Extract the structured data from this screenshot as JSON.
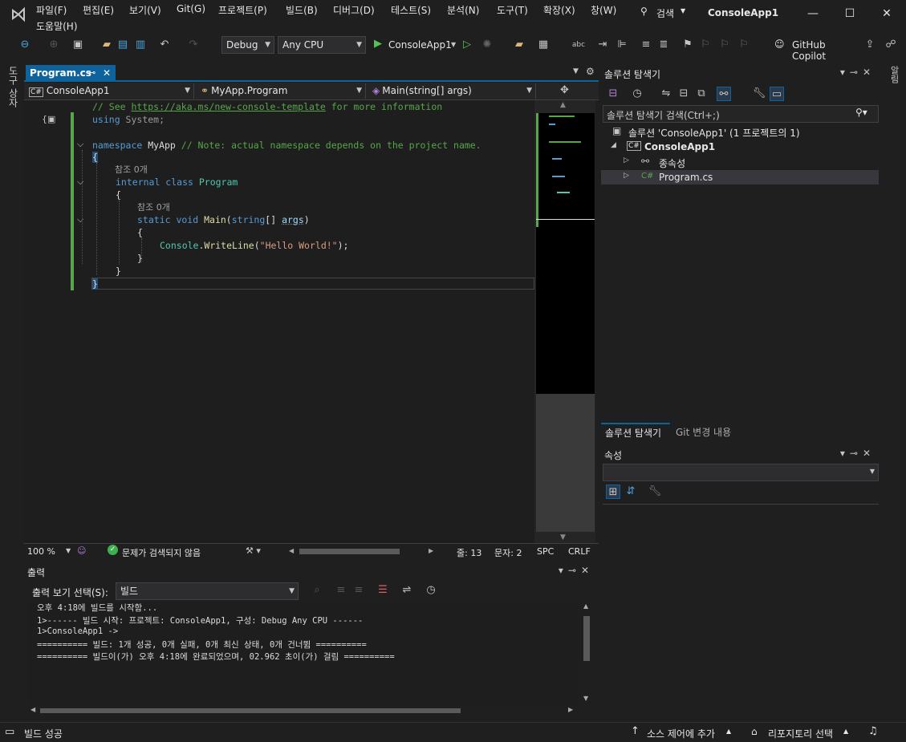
{
  "title_bar": {
    "menus": [
      "파일(F)",
      "편집(E)",
      "보기(V)",
      "Git(G)",
      "프로젝트(P)",
      "빌드(B)",
      "디버그(D)",
      "테스트(S)",
      "분석(N)",
      "도구(T)",
      "확장(X)",
      "창(W)"
    ],
    "help_menu": "도움말(H)",
    "search_label": "검색",
    "solution_name": "ConsoleApp1"
  },
  "toolbar": {
    "config": "Debug",
    "platform": "Any CPU",
    "run_target": "ConsoleApp1",
    "copilot_label": "GitHub Copilot"
  },
  "left_rail": {
    "toolbox_label": "도구 상자"
  },
  "right_rail": {
    "label": "알림"
  },
  "editor": {
    "tab_label": "Program.cs",
    "nav": {
      "project": "ConsoleApp1",
      "class": "MyApp.Program",
      "member": "Main(string[] args)"
    },
    "code": {
      "l1_comment": "// See ",
      "l1_link": "https://aka.ms/new-console-template",
      "l1_tail": " for more information",
      "l2_kw": "using",
      "l2_rest": " System;",
      "l4_kw": "namespace",
      "l4_name": " MyApp ",
      "l4_comment": "// Note: actual namespace depends on the project name.",
      "l5": "{",
      "ref1": "참조 0개",
      "l6_kw": "internal class ",
      "l6_type": "Program",
      "l7": "{",
      "ref2": "참조 0개",
      "l8_kw": "static void ",
      "l8_fn": "Main",
      "l8_p1": "(",
      "l8_kw2": "string",
      "l8_p2": "[] ",
      "l8_arg": "args",
      "l8_p3": ")",
      "l9": "{",
      "l10_type": "Console",
      "l10_dot": ".",
      "l10_fn": "WriteLine",
      "l10_p1": "(",
      "l10_str": "\"Hello World!\"",
      "l10_p2": ");",
      "l11": "}",
      "l12": "}",
      "l13": "}"
    },
    "status": {
      "zoom": "100 %",
      "issues": "문제가 검색되지 않음",
      "line": "줄: 13",
      "char": "문자: 2",
      "whitespace": "SPC",
      "line_ending": "CRLF"
    }
  },
  "output": {
    "title": "출력",
    "source_label": "출력 보기 선택(S):",
    "source_value": "빌드",
    "lines": [
      "오후 4:18에 빌드를 시작함...",
      "1>------ 빌드 시작: 프로젝트: ConsoleApp1, 구성: Debug Any CPU ------",
      "1>ConsoleApp1 ->",
      "========== 빌드: 1개 성공, 0개 실패, 0개 최신 상태, 0개 건너뜀 ==========",
      "========== 빌드이(가) 오후 4:18에 완료되었으며, 02.962 초이(가) 걸림 =========="
    ]
  },
  "solution_explorer": {
    "title": "솔루션 탐색기",
    "search_placeholder": "솔루션 탐색기 검색(Ctrl+;)",
    "solution_node": "솔루션 'ConsoleApp1' (1 프로젝트의 1)",
    "project_node": "ConsoleApp1",
    "dependencies_node": "종속성",
    "file_node": "Program.cs",
    "tab_active": "솔루션 탐색기",
    "tab_git": "Git 변경 내용"
  },
  "properties": {
    "title": "속성"
  },
  "status_bar": {
    "message": "빌드 성공",
    "source_control": "소스 제어에 추가",
    "repository": "리포지토리 선택"
  },
  "colors": {
    "accent": "#0e639c",
    "background": "#1f1f1f",
    "editor_bg": "#1e1e1e",
    "change_marker": "#57a64a"
  }
}
